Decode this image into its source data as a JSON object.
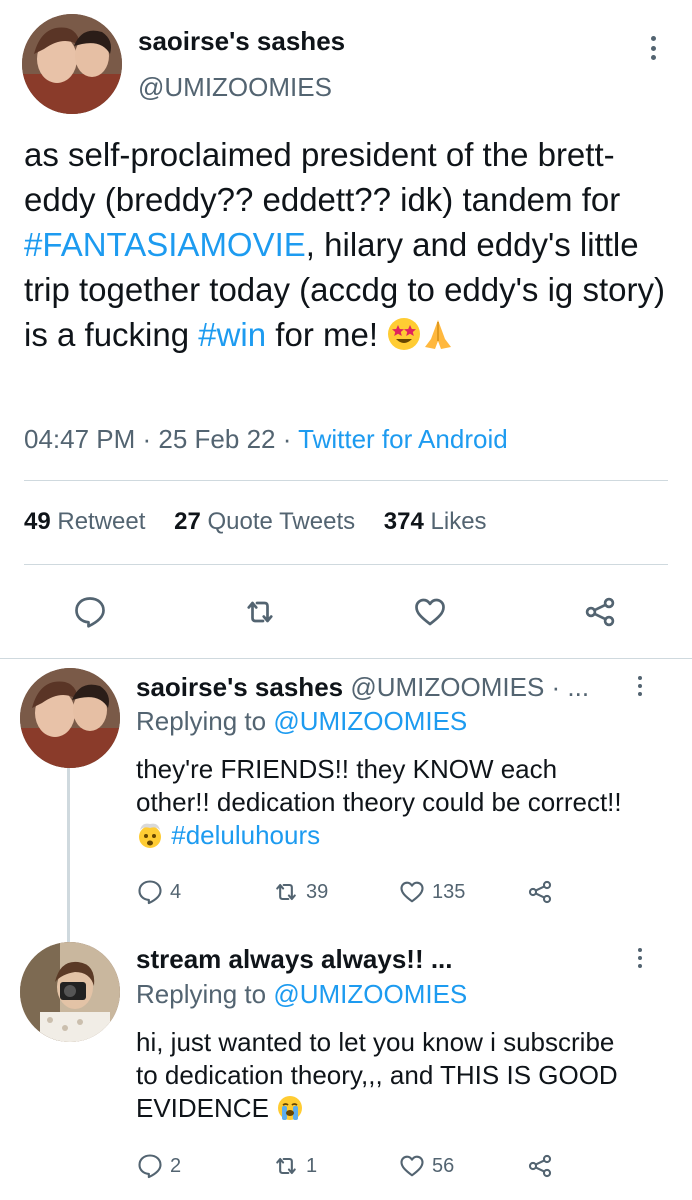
{
  "main_tweet": {
    "name": "saoirse's sashes",
    "handle": "@UMIZOOMIES",
    "text_1": "as self-proclaimed president of the brett-eddy (breddy?? eddett?? idk) tandem for ",
    "hashtag_1": "#FANTASIAMOVIE",
    "text_2": ", hilary and eddy's little trip together today (accdg to eddy's ig story) is a fucking ",
    "hashtag_2": "#win",
    "text_3": " for me!",
    "time": "04:47 PM",
    "date": "25 Feb 22",
    "sep": " · ",
    "source": "Twitter for Android",
    "stats": {
      "retweets_count": "49",
      "retweets_label": "Retweet",
      "quotes_count": "27",
      "quotes_label": "Quote Tweets",
      "likes_count": "374",
      "likes_label": "Likes"
    }
  },
  "replies": [
    {
      "name": "saoirse's sashes",
      "handle_suffix": " @UMIZOOMIES · ...",
      "replying_label": "Replying to ",
      "replying_to": "@UMIZOOMIES",
      "text": "they're FRIENDS!! they KNOW each other!! dedication theory could be correct!! ",
      "hashtag": "#deluluhours",
      "replies": "4",
      "retweets": "39",
      "likes": "135"
    },
    {
      "name": "stream always always!! ...",
      "replying_label": "Replying to ",
      "replying_to": "@UMIZOOMIES",
      "text": "hi, just wanted to let you know i subscribe to dedication theory,,, and THIS IS GOOD EVIDENCE ",
      "replies": "2",
      "retweets": "1",
      "likes": "56"
    }
  ],
  "icons": {
    "reply": "reply-icon",
    "retweet": "retweet-icon",
    "like": "heart-icon",
    "share": "share-icon",
    "more": "more-options-icon"
  },
  "colors": {
    "link": "#1d9bf0",
    "secondary": "#536471",
    "divider": "#cfd9de"
  }
}
